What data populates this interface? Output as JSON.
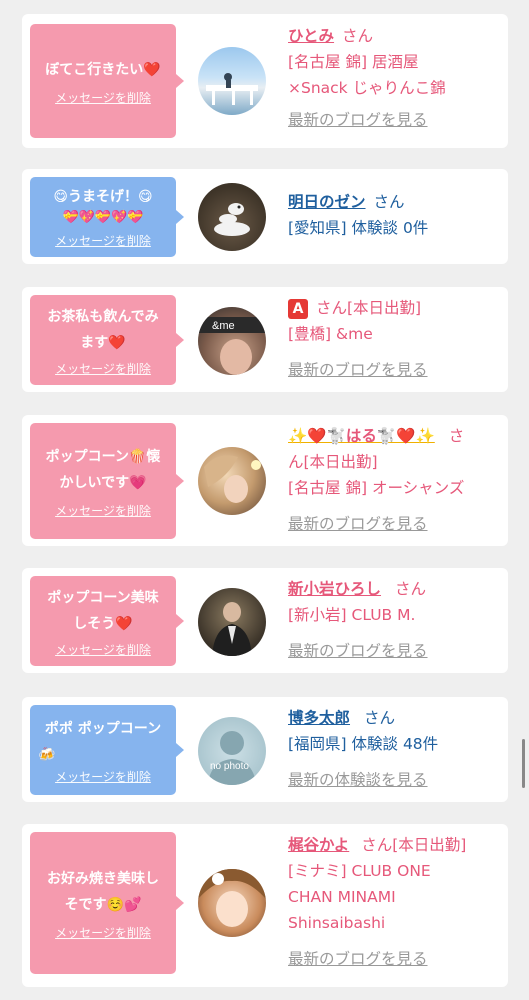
{
  "cards": [
    {
      "message": "ぼてこ行きたい❤️",
      "delete_label": "メッセージを削除",
      "name": "ひとみ",
      "suffix": "さん",
      "line1": "[名古屋 錦] 居酒屋",
      "line2": "×Snack じゃりんこ錦",
      "link": "最新のブログを見る"
    },
    {
      "message": "😋うまそげ！😋",
      "message2": "💝💖💝💖💝",
      "delete_label": "メッセージを削除",
      "name": "明日のゼン",
      "suffix": "さん",
      "line1": "[愛知県] 体験談 0件"
    },
    {
      "message": "お茶私も飲んでみ",
      "message2": "ます❤️",
      "delete_label": "メッセージを削除",
      "name": "🅰️",
      "suffix": "さん[本日出勤]",
      "line1": "[豊橋] &me",
      "avatar_text": "&me",
      "link": "最新のブログを見る"
    },
    {
      "message": "ポップコーン🍿懐",
      "message2": "かしいです💗",
      "delete_label": "メッセージを削除",
      "name": "✨❤️🐩はる🐩❤️✨",
      "suffix": "さ",
      "suffix2": "ん[本日出勤]",
      "line1": "[名古屋 錦] オーシャンズ",
      "link": "最新のブログを見る"
    },
    {
      "message": "ポップコーン美味",
      "message2": "しそう❤️",
      "delete_label": "メッセージを削除",
      "name": "新小岩ひろし",
      "suffix": "さん",
      "line1": "[新小岩] CLUB M.",
      "link": "最新のブログを見る"
    },
    {
      "message": "ポポ ポップコーン",
      "message2": "🍻",
      "delete_label": "メッセージを削除",
      "name": "博多太郎",
      "suffix": "さん",
      "line1": "[福岡県] 体験談 48件",
      "avatar_text": "no photo",
      "link": "最新の体験談を見る"
    },
    {
      "message": "お好み焼き美味し",
      "message2": "そです☺️💕",
      "delete_label": "メッセージを削除",
      "name": "梶谷かよ",
      "suffix": "さん[本日出勤]",
      "line1": "[ミナミ] CLUB ONE",
      "line2": "CHAN MINAMI",
      "line3": "Shinsaibashi",
      "link": "最新のブログを見る"
    }
  ],
  "colors": {
    "pink_bubble": "#f59aae",
    "blue_bubble": "#86b4ee",
    "pink_text": "#e6587a",
    "blue_text": "#1f5f9e"
  }
}
